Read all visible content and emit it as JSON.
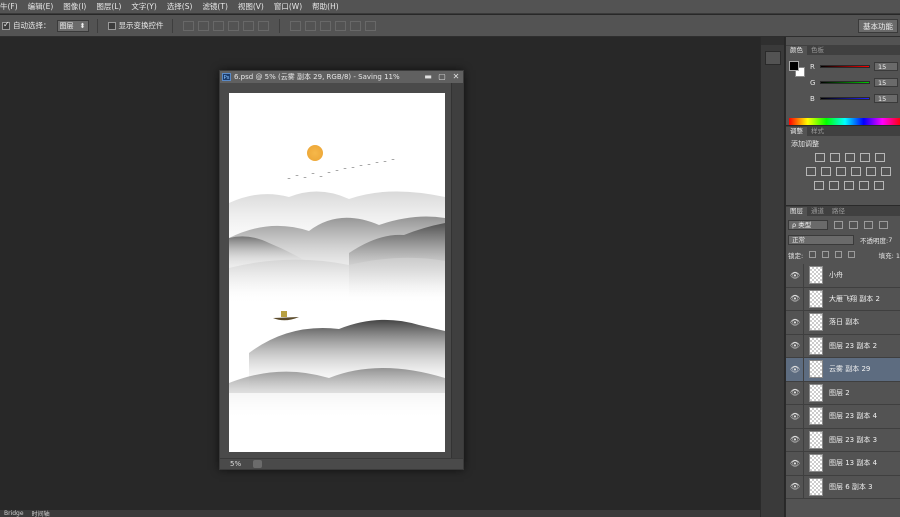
{
  "menu": [
    "牛(F)",
    "编辑(E)",
    "图像(I)",
    "图层(L)",
    "文字(Y)",
    "选择(S)",
    "滤镜(T)",
    "视图(V)",
    "窗口(W)",
    "帮助(H)"
  ],
  "options": {
    "auto_select_label": "自动选择：",
    "auto_select_value": "图层",
    "show_transform_label": "显示变换控件",
    "workspace": "基本功能"
  },
  "document": {
    "title": "6.psd @ 5% (云雾 副本 29, RGB/8) - Saving 11%",
    "zoom": "5%"
  },
  "color_panel": {
    "tabs": [
      "颜色",
      "色板"
    ],
    "channels": [
      {
        "label": "R",
        "value": "15",
        "color": "#d02020"
      },
      {
        "label": "G",
        "value": "15",
        "color": "#20b030"
      },
      {
        "label": "B",
        "value": "15",
        "color": "#2030d0"
      }
    ]
  },
  "adjust_panel": {
    "tabs": [
      "调整",
      "样式"
    ],
    "title": "添加调整"
  },
  "layers_panel": {
    "tabs": [
      "图层",
      "通道",
      "路径"
    ],
    "filter_kind": "ρ 类型",
    "blend_mode": "正常",
    "opacity_label": "不透明度:",
    "opacity_value": "7",
    "lock_label": "锁定:",
    "fill_label": "填充:",
    "fill_value": "1",
    "layers": [
      {
        "name": "小舟",
        "selected": false
      },
      {
        "name": "大雁飞翔 副本 2",
        "selected": false
      },
      {
        "name": "落日 副本",
        "selected": false
      },
      {
        "name": "图层 23 副本 2",
        "selected": false
      },
      {
        "name": "云雾 副本 29",
        "selected": true
      },
      {
        "name": "图层 2",
        "selected": false
      },
      {
        "name": "图层 23 副本 4",
        "selected": false
      },
      {
        "name": "图层 23 副本 3",
        "selected": false
      },
      {
        "name": "图层 13 副本 4",
        "selected": false
      },
      {
        "name": "图层 6 副本 3",
        "selected": false
      }
    ]
  },
  "bottom_tabs": [
    "Bridge",
    "时间轴"
  ]
}
